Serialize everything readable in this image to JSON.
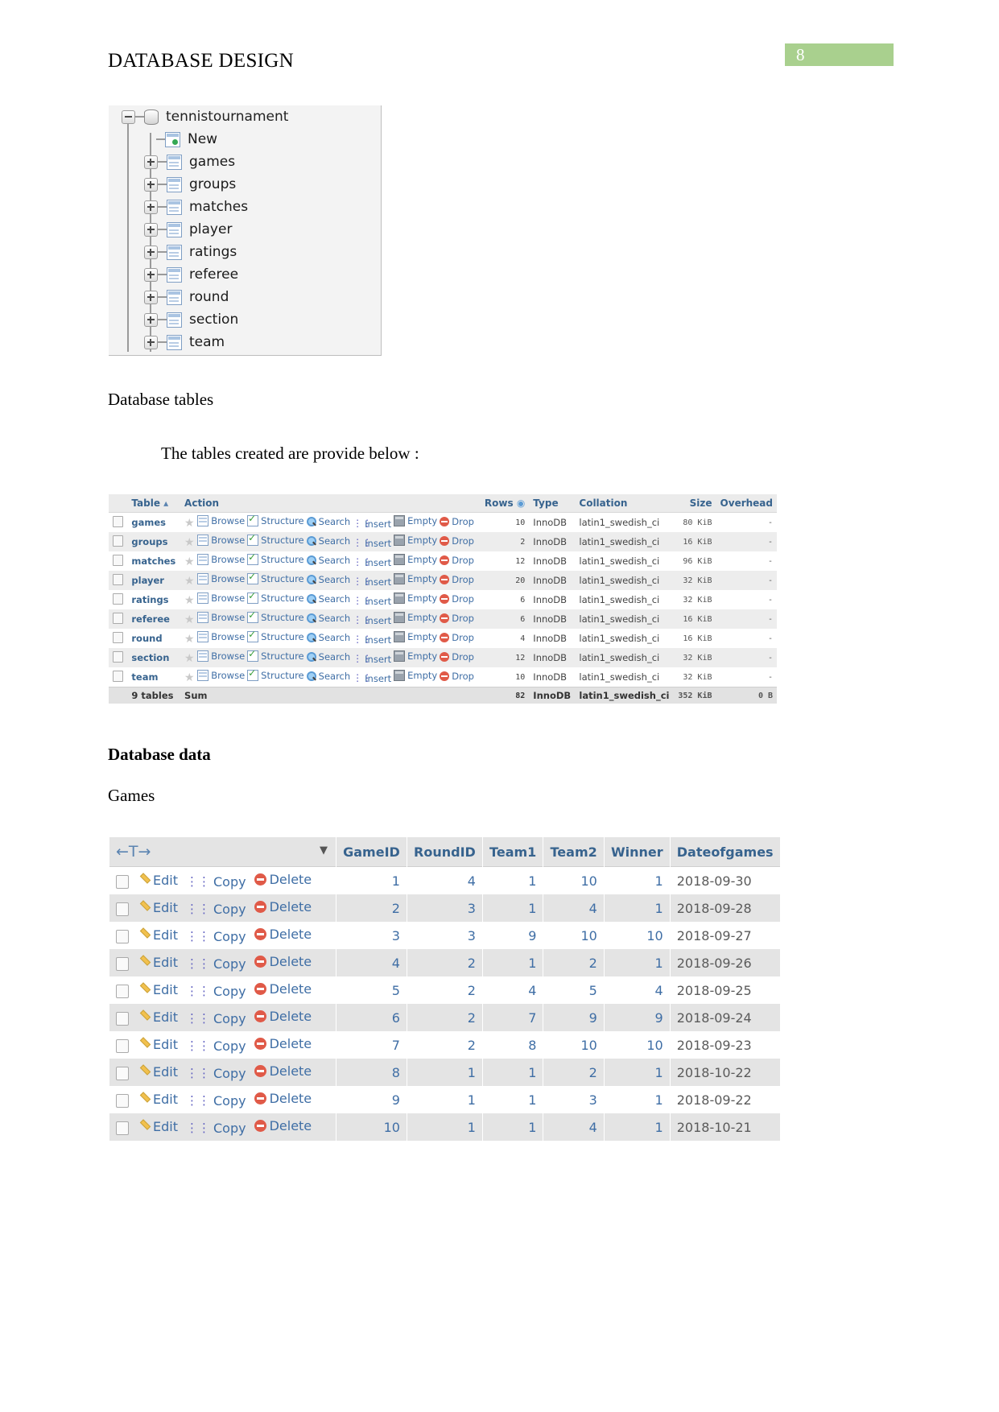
{
  "document": {
    "title": "DATABASE DESIGN",
    "page_number": "8",
    "page_badge_color": "#a9d08e",
    "captions": {
      "database_tables": "Database tables",
      "intro": "The tables created are provide below :",
      "database_data": "Database data",
      "games": "Games"
    }
  },
  "tree": {
    "root": "tennistournament",
    "items": [
      {
        "label": "New",
        "icon": "new-table-icon",
        "toggle": "none"
      },
      {
        "label": "games",
        "icon": "table-icon",
        "toggle": "plus"
      },
      {
        "label": "groups",
        "icon": "table-icon",
        "toggle": "plus"
      },
      {
        "label": "matches",
        "icon": "table-icon",
        "toggle": "plus"
      },
      {
        "label": "player",
        "icon": "table-icon",
        "toggle": "plus"
      },
      {
        "label": "ratings",
        "icon": "table-icon",
        "toggle": "plus"
      },
      {
        "label": "referee",
        "icon": "table-icon",
        "toggle": "plus"
      },
      {
        "label": "round",
        "icon": "table-icon",
        "toggle": "plus"
      },
      {
        "label": "section",
        "icon": "table-icon",
        "toggle": "plus"
      },
      {
        "label": "team",
        "icon": "table-icon",
        "toggle": "plus"
      }
    ]
  },
  "table_list": {
    "headers": {
      "table": "Table",
      "action": "Action",
      "rows": "Rows",
      "type": "Type",
      "collation": "Collation",
      "size": "Size",
      "overhead": "Overhead"
    },
    "actions": [
      "Browse",
      "Structure",
      "Search",
      "Insert",
      "Empty",
      "Drop"
    ],
    "rows": [
      {
        "name": "games",
        "rows": "10",
        "type": "InnoDB",
        "collation": "latin1_swedish_ci",
        "size": "80 KiB",
        "overhead": "-"
      },
      {
        "name": "groups",
        "rows": "2",
        "type": "InnoDB",
        "collation": "latin1_swedish_ci",
        "size": "16 KiB",
        "overhead": "-"
      },
      {
        "name": "matches",
        "rows": "12",
        "type": "InnoDB",
        "collation": "latin1_swedish_ci",
        "size": "96 KiB",
        "overhead": "-"
      },
      {
        "name": "player",
        "rows": "20",
        "type": "InnoDB",
        "collation": "latin1_swedish_ci",
        "size": "32 KiB",
        "overhead": "-"
      },
      {
        "name": "ratings",
        "rows": "6",
        "type": "InnoDB",
        "collation": "latin1_swedish_ci",
        "size": "32 KiB",
        "overhead": "-"
      },
      {
        "name": "referee",
        "rows": "6",
        "type": "InnoDB",
        "collation": "latin1_swedish_ci",
        "size": "16 KiB",
        "overhead": "-"
      },
      {
        "name": "round",
        "rows": "4",
        "type": "InnoDB",
        "collation": "latin1_swedish_ci",
        "size": "16 KiB",
        "overhead": "-"
      },
      {
        "name": "section",
        "rows": "12",
        "type": "InnoDB",
        "collation": "latin1_swedish_ci",
        "size": "32 KiB",
        "overhead": "-"
      },
      {
        "name": "team",
        "rows": "10",
        "type": "InnoDB",
        "collation": "latin1_swedish_ci",
        "size": "32 KiB",
        "overhead": "-"
      }
    ],
    "summary": {
      "count_label": "9 tables",
      "sum_label": "Sum",
      "rows": "82",
      "type": "InnoDB",
      "collation": "latin1_swedish_ci",
      "size": "352 KiB",
      "overhead": "0 B"
    }
  },
  "games_table": {
    "row_actions": [
      "Edit",
      "Copy",
      "Delete"
    ],
    "sort_control": "←T→",
    "headers": [
      "GameID",
      "RoundID",
      "Team1",
      "Team2",
      "Winner",
      "Dateofgames"
    ],
    "rows": [
      {
        "GameID": "1",
        "RoundID": "4",
        "Team1": "1",
        "Team2": "10",
        "Winner": "1",
        "Dateofgames": "2018-09-30"
      },
      {
        "GameID": "2",
        "RoundID": "3",
        "Team1": "1",
        "Team2": "4",
        "Winner": "1",
        "Dateofgames": "2018-09-28"
      },
      {
        "GameID": "3",
        "RoundID": "3",
        "Team1": "9",
        "Team2": "10",
        "Winner": "10",
        "Dateofgames": "2018-09-27"
      },
      {
        "GameID": "4",
        "RoundID": "2",
        "Team1": "1",
        "Team2": "2",
        "Winner": "1",
        "Dateofgames": "2018-09-26"
      },
      {
        "GameID": "5",
        "RoundID": "2",
        "Team1": "4",
        "Team2": "5",
        "Winner": "4",
        "Dateofgames": "2018-09-25"
      },
      {
        "GameID": "6",
        "RoundID": "2",
        "Team1": "7",
        "Team2": "9",
        "Winner": "9",
        "Dateofgames": "2018-09-24"
      },
      {
        "GameID": "7",
        "RoundID": "2",
        "Team1": "8",
        "Team2": "10",
        "Winner": "10",
        "Dateofgames": "2018-09-23"
      },
      {
        "GameID": "8",
        "RoundID": "1",
        "Team1": "1",
        "Team2": "2",
        "Winner": "1",
        "Dateofgames": "2018-10-22"
      },
      {
        "GameID": "9",
        "RoundID": "1",
        "Team1": "1",
        "Team2": "3",
        "Winner": "1",
        "Dateofgames": "2018-09-22"
      },
      {
        "GameID": "10",
        "RoundID": "1",
        "Team1": "1",
        "Team2": "4",
        "Winner": "1",
        "Dateofgames": "2018-10-21"
      }
    ]
  }
}
